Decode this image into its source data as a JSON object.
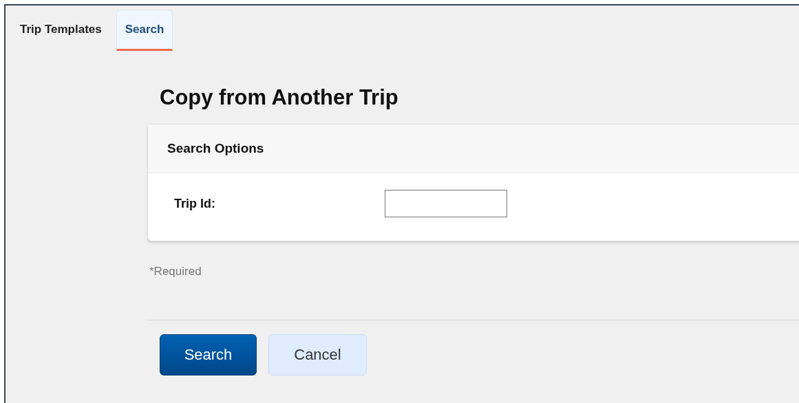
{
  "tabs": [
    {
      "label": "Trip Templates",
      "selected": false
    },
    {
      "label": "Search",
      "selected": true
    }
  ],
  "page_title": "Copy from Another Trip",
  "panel": {
    "title": "Search Options",
    "fields": [
      {
        "label": "Trip Id:"
      }
    ]
  },
  "required_note": "*Required",
  "buttons": [
    {
      "label": "Search",
      "kind": "primary"
    },
    {
      "label": "Cancel",
      "kind": "secondary"
    }
  ]
}
